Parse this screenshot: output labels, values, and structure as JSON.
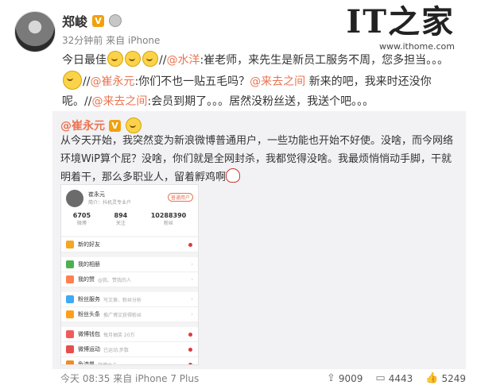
{
  "post": {
    "author": "郑峻",
    "verified_badge": "V",
    "meta": "32分钟前 来自 iPhone",
    "text_segments": [
      {
        "t": "今日最佳"
      },
      {
        "t": "//"
      },
      {
        "t": "@水洋",
        "link": true
      },
      {
        "t": ":崔老师，来先生是新员工服务不周，您多担当。。。"
      },
      {
        "t": "//"
      },
      {
        "t": "@崔永元",
        "link": true
      },
      {
        "t": ":你们不也一贴五毛吗？"
      },
      {
        "t": "@来去之间",
        "link": true
      },
      {
        "t": " 新来的吧，我来时还没你呢。"
      },
      {
        "t": "//"
      },
      {
        "t": "@来去之间",
        "link": true
      },
      {
        "t": ":会员到期了。。。居然没粉丝送，我送个吧。。。"
      }
    ]
  },
  "logo": {
    "mark": "IT之家",
    "url": "www.ithome.com"
  },
  "repost": {
    "author": "@崔永元",
    "verified_badge": "V",
    "text": "从今天开始，我突然变为新浪微博普通用户，一些功能也开始不好使。没啥，而今网络环境WiP算个屁？没啥，你们就是全网封杀，我都觉得没啥。我最烦悄悄动手脚，干就明着干，那么多职业人，留着孵鸡啊",
    "footer_meta": "今天 08:35 来自 iPhone 7 Plus",
    "reposts": "9009",
    "comments": "4443",
    "likes": "5249"
  },
  "phone": {
    "name": "崔永元",
    "intro": "简介：抖机灵专业户",
    "member_tag": "普通用户",
    "stats": [
      {
        "n": "6705",
        "l": "微博"
      },
      {
        "n": "894",
        "l": "关注"
      },
      {
        "n": "10288390",
        "l": "粉丝"
      }
    ],
    "rows": [
      {
        "label": "新的好友",
        "sub": "",
        "color": "#f5a623",
        "dot": true,
        "gap": false
      },
      {
        "label": "我的相册",
        "sub": "",
        "color": "#4cb050",
        "dot": false,
        "gap": true
      },
      {
        "label": "我的赞",
        "sub": "@我、赞我的人",
        "color": "#ff7f50",
        "dot": false,
        "gap": false
      },
      {
        "label": "粉丝服务",
        "sub": "写文章、粉丝分析",
        "color": "#3fa9f5",
        "dot": false,
        "gap": true
      },
      {
        "label": "粉丝头条",
        "sub": "推广博文获得粉丝",
        "color": "#ff9f1c",
        "dot": false,
        "gap": false
      },
      {
        "label": "微博钱包",
        "sub": "每月抽奖 20万",
        "color": "#f25a5a",
        "dot": true,
        "gap": true
      },
      {
        "label": "微博运动",
        "sub": "已运动,步数",
        "color": "#e94e4e",
        "dot": true,
        "gap": false
      },
      {
        "label": "免流量",
        "sub": "微博大卡",
        "color": "#f08a24",
        "dot": true,
        "gap": false
      }
    ]
  }
}
